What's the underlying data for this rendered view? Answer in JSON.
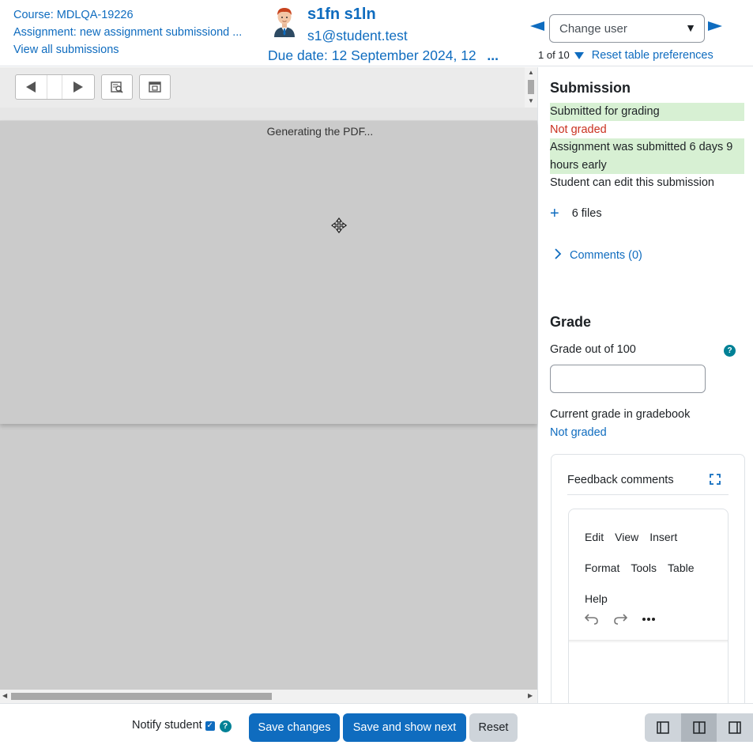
{
  "header": {
    "course": "Course: MDLQA-19226",
    "assignment": "Assignment: new assignment submissiond ...",
    "view_all": "View all submissions",
    "user_name": "s1fn s1ln",
    "user_email": "s1@student.test",
    "due_date": "Due date: 12 September 2024, 12",
    "due_date_ellipsis": "...",
    "change_user_placeholder": "Change user",
    "counter": "1 of 10",
    "reset_table": "Reset table preferences"
  },
  "viewer": {
    "status": "Generating the PDF..."
  },
  "submission": {
    "title": "Submission",
    "status_lines": [
      "Submitted for grading",
      "Not graded",
      "Assignment was submitted 6 days 9 hours early",
      "Student can edit this submission"
    ],
    "files": "6 files",
    "comments": "Comments (0)"
  },
  "grade": {
    "title": "Grade",
    "grade_label": "Grade out of 100",
    "gradebook_label": "Current grade in gradebook",
    "gradebook_value": "Not graded",
    "feedback_title": "Feedback comments",
    "menu": [
      "Edit",
      "View",
      "Insert",
      "Format",
      "Tools",
      "Table",
      "Help"
    ]
  },
  "footer": {
    "notify": "Notify student",
    "save": "Save changes",
    "save_next": "Save and show next",
    "reset": "Reset"
  },
  "colors": {
    "accent": "#0f6cbf",
    "success_bg": "#d7f0d3",
    "danger": "#ca3120",
    "help": "#008196"
  },
  "icons": [
    "avatar",
    "prev-user-icon",
    "next-user-icon",
    "filter-icon",
    "move-icon",
    "plus-icon",
    "chevron-right-icon",
    "help-icon",
    "expand-icon",
    "undo-icon",
    "redo-icon",
    "more-icon",
    "layout-collapse-grade-icon",
    "layout-default-icon",
    "layout-collapse-review-icon"
  ]
}
